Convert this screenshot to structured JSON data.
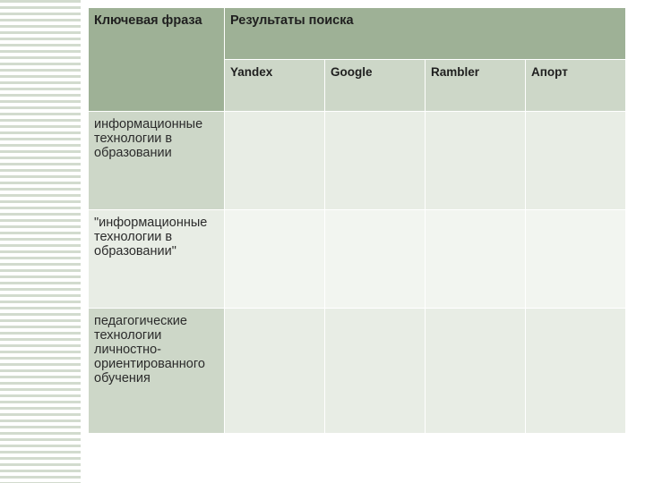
{
  "table": {
    "header": {
      "key_phrase": "Ключевая фраза",
      "results": "Результаты поиска",
      "engines": [
        "Yandex",
        "Google",
        "Rambler",
        "Апорт"
      ]
    },
    "rows": [
      {
        "phrase": "информационные технологии в образовании",
        "values": [
          "",
          "",
          "",
          ""
        ]
      },
      {
        "phrase": "\"информационные технологии в образовании\"",
        "values": [
          "",
          "",
          "",
          ""
        ]
      },
      {
        "phrase": "педагогические технологии личностно-ориентированного обучения",
        "values": [
          "",
          "",
          "",
          ""
        ]
      }
    ]
  }
}
